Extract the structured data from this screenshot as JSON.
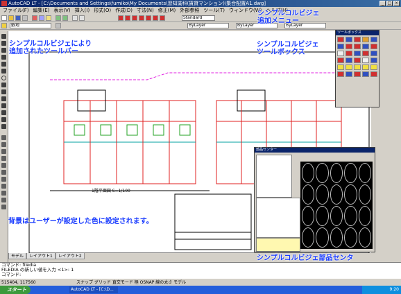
{
  "window": {
    "title": "AutoCAD LT - [C:\\Documents and Settings\\fumiko\\My Documents\\習知識科(賃貸マンション)\\集合配置A1.dwg]"
  },
  "menu": [
    "ファイル(F)",
    "編集(E)",
    "表示(V)",
    "挿入(I)",
    "形式(O)",
    "作成(D)",
    "寸法(N)",
    "修正(M)",
    "外部参照",
    "ツール(T)",
    "ウィンドウ(W)",
    "ヘルプ(H)"
  ],
  "toolbar": {
    "layer_combo": "敷地",
    "style_combo": "Standard",
    "color_combo": "ByLayer",
    "linetype_combo": "ByLayer",
    "lineweight_combo": "ByLayer"
  },
  "annotations": {
    "menu_added_line1": "シンプルコルビジェ",
    "menu_added_line2": "追加メニュー",
    "toolbar_added_line1": "シンプルコルビジェにより",
    "toolbar_added_line2": "追加されたツールバー",
    "toolbox_line1": "シンプルコルビジェ",
    "toolbox_line2": "ツールボックス",
    "background_note": "背景はユーザーが設定した色に設定されます。",
    "parts_center_label": "シンプルコルビジェ部品センタ"
  },
  "drawing": {
    "plan_label": "1階平面図 S=1/100"
  },
  "toolbox": {
    "title": "ツールボックス"
  },
  "parts_center": {
    "title": "部品センター"
  },
  "layout_tabs": [
    "モデル",
    "レイアウト1",
    "レイアウト2"
  ],
  "command": {
    "line1": "コマンド: filedia",
    "line2": "FILEDIA の新しい値を入力 <1>: 1",
    "line3": "コマンド:"
  },
  "status": {
    "coords": "515404, 117560",
    "toggles": "スナップ グリッド 直交モード 極 OSNAP 線の太さ モデル"
  },
  "taskbar": {
    "start": "スタート",
    "app": "AutoCAD LT - [C:\\D...",
    "clock": "9:20"
  }
}
